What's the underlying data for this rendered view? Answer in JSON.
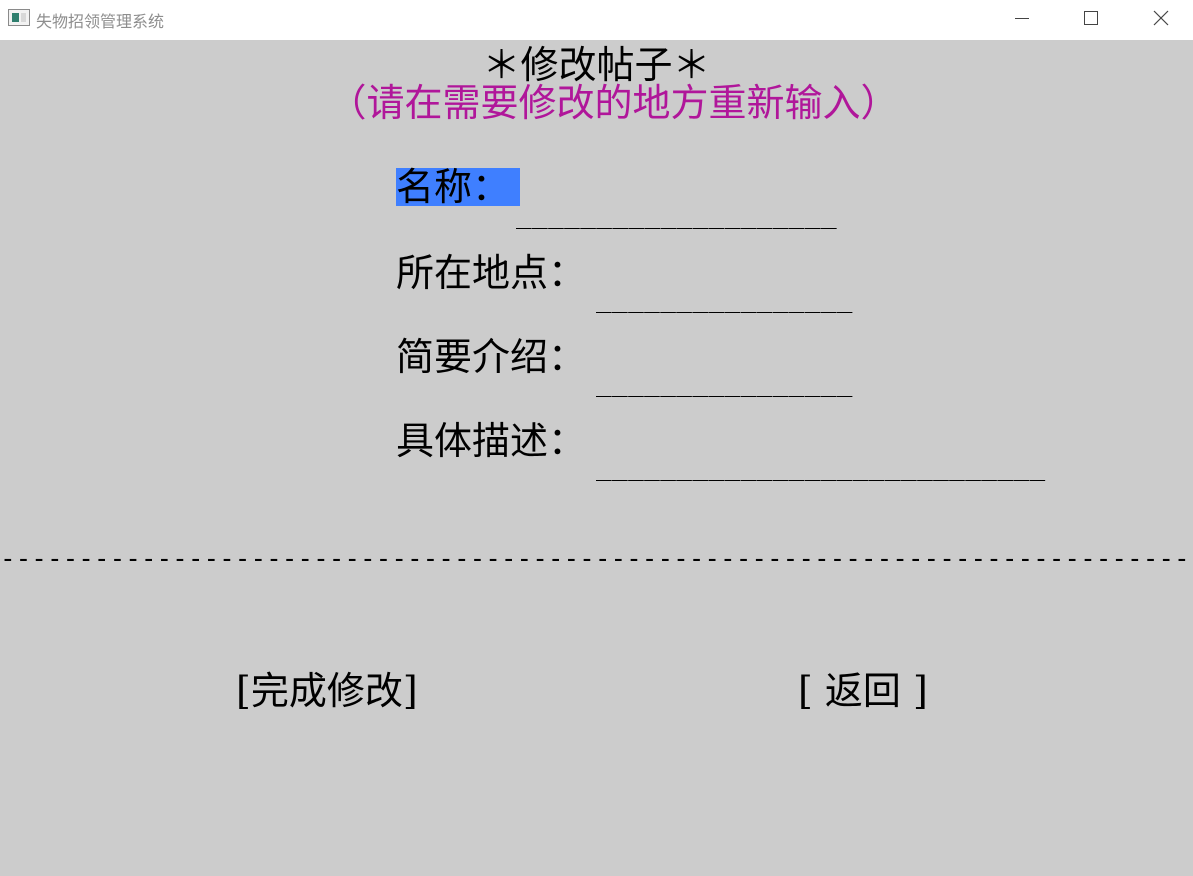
{
  "window": {
    "title": "失物招领管理系统",
    "app_icon": "window-app-icon",
    "controls": {
      "minimize": "minimize-icon",
      "maximize": "maximize-icon",
      "close": "close-icon"
    }
  },
  "page": {
    "heading": "＊修改帖子＊",
    "subheading": "（请在需要修改的地方重新输入）"
  },
  "form": {
    "name_label": "名称：",
    "name_line": "____________________",
    "location_label": "所在地点：",
    "location_line": "________________",
    "summary_label": "简要介绍：",
    "summary_line": "________________",
    "detail_label": "具体描述：",
    "detail_line": "____________________________"
  },
  "divider": "------------------------------------------------------------------------------------------------------",
  "actions": {
    "finish_label": "[完成修改]",
    "back_label": "[ 返回 ]"
  },
  "colors": {
    "background": "#cccccc",
    "subheading": "#b0169a",
    "selection": "#3f7fff"
  }
}
